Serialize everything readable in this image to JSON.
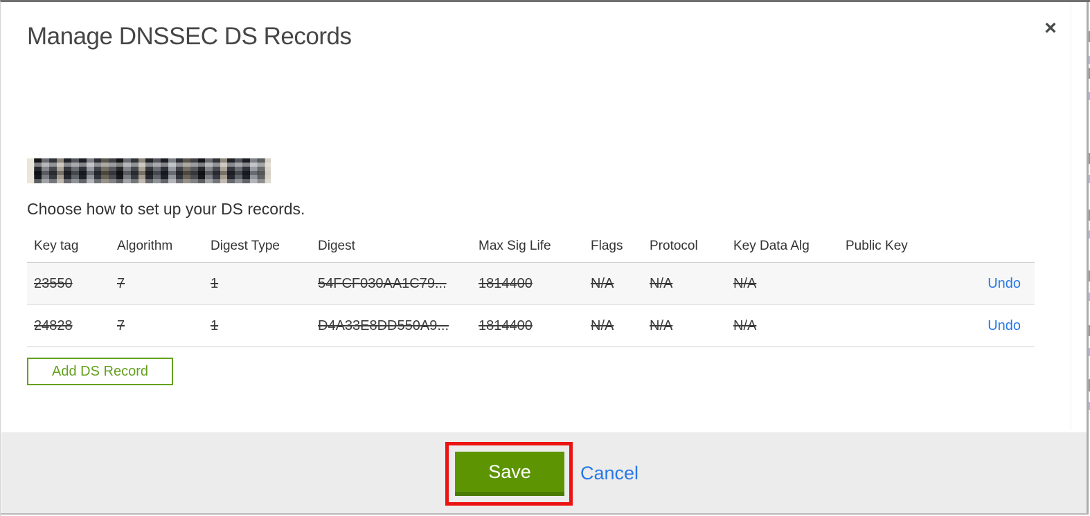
{
  "modal": {
    "title": "Manage DNSSEC DS Records",
    "close_glyph": "×",
    "instruction": "Choose how to set up your DS records.",
    "table": {
      "headers": [
        "Key tag",
        "Algorithm",
        "Digest Type",
        "Digest",
        "Max Sig Life",
        "Flags",
        "Protocol",
        "Key Data Alg",
        "Public Key"
      ],
      "rows": [
        {
          "cells": [
            "23550",
            "7",
            "1",
            "54FCF030AA1C79...",
            "1814400",
            "N/A",
            "N/A",
            "N/A",
            ""
          ],
          "action": "Undo",
          "struck": true
        },
        {
          "cells": [
            "24828",
            "7",
            "1",
            "D4A33E8DD550A9...",
            "1814400",
            "N/A",
            "N/A",
            "N/A",
            ""
          ],
          "action": "Undo",
          "struck": true
        }
      ]
    },
    "add_ds_record_button": "Add DS Record",
    "footer": {
      "save_button": "Save",
      "cancel_link": "Cancel"
    }
  },
  "colors": {
    "accent_green": "#5d9502",
    "outline_green": "#64a01e",
    "link_blue": "#2779e6",
    "annotation_red": "#ec1313",
    "footer_gray": "#ececec",
    "row_stripe_gray": "#f7f7f7"
  }
}
